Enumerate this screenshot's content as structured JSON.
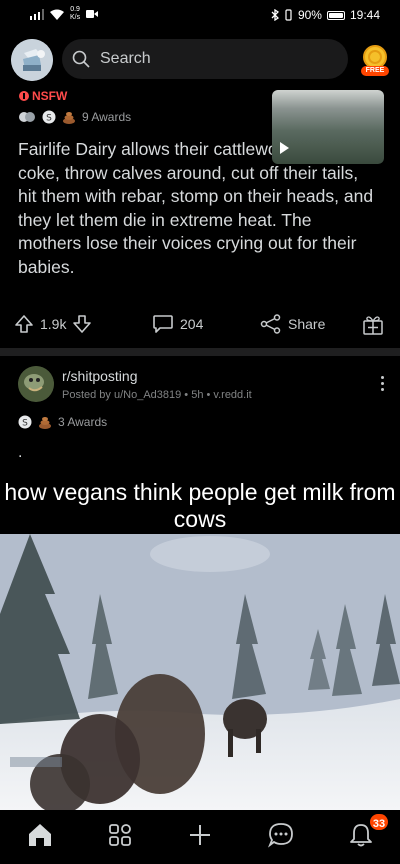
{
  "status_bar": {
    "net_speed": "0.9",
    "net_unit": "K/s",
    "battery": "90%",
    "time": "19:44"
  },
  "header": {
    "search_placeholder": "Search",
    "coin_label": "FREE"
  },
  "post1": {
    "nsfw_label": "NSFW",
    "awards": "9 Awards",
    "title": "Fairlife Dairy allows their cattleworkers to do coke, throw calves around, cut off their tails, hit them with rebar, stomp on their heads, and they let them die in extreme heat. The mothers lose their voices crying out for their babies.",
    "upvotes": "1.9k",
    "comments": "204",
    "share_label": "Share"
  },
  "post2": {
    "subreddit": "r/shitposting",
    "byline": "Posted by u/No_Ad3819 • 5h • v.redd.it",
    "awards": "3 Awards",
    "body": ".",
    "caption": "how vegans think people get milk from cows"
  },
  "bottom_nav": {
    "items": [
      "home-icon",
      "communities-icon",
      "create-icon",
      "chat-icon",
      "inbox-icon"
    ],
    "inbox_badge": "33"
  },
  "colors": {
    "background": "#000000",
    "text": "#d7dadc",
    "nsfw": "#ff4b4b",
    "badge": "#ff4500"
  }
}
